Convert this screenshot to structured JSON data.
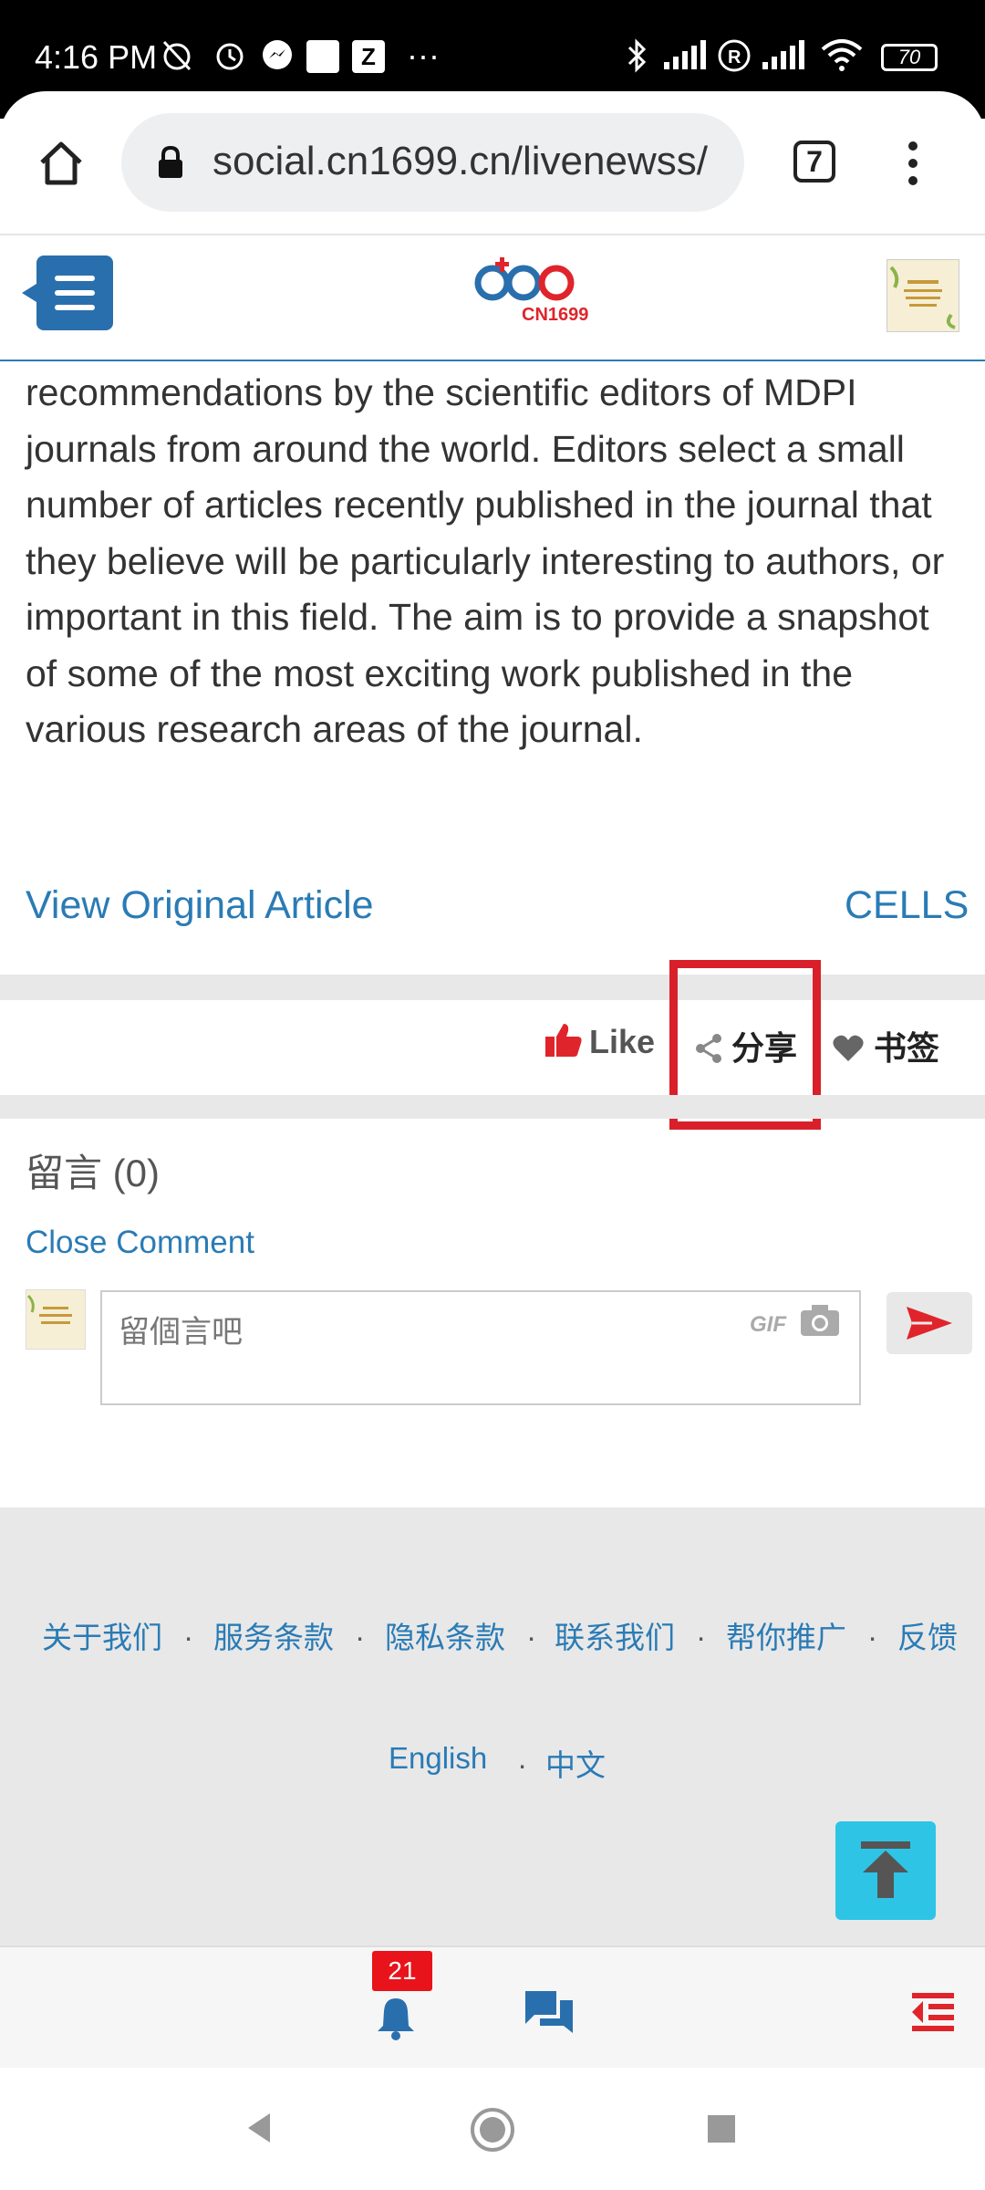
{
  "status_bar": {
    "time": "4:16 PM",
    "battery": "70",
    "overflow": "···"
  },
  "browser": {
    "url": "social.cn1699.cn/livenewss/",
    "tab_count": "7"
  },
  "site_header": {
    "logo_text": "CN1699"
  },
  "article": {
    "body": "recommendations by the scientific editors of MDPI journals from around the world. Editors select a small number of articles recently published in the journal that they believe will be particularly interesting to authors, or important in this field. The aim is to provide a snapshot of some of the most exciting work published in the various research areas of the journal.",
    "view_original": "View Original Article",
    "tag": "CELLS"
  },
  "actions": {
    "like": "Like",
    "share": "分享",
    "bookmark": "书签"
  },
  "comments": {
    "title": "留言 (0)",
    "close": "Close Comment",
    "placeholder": "留個言吧",
    "gif": "GIF"
  },
  "footer": {
    "links": [
      "关于我们",
      "服务条款",
      "隐私条款",
      "联系我们",
      "帮你推广",
      "反馈"
    ],
    "separator": ".",
    "lang_en": "English",
    "lang_zh": "中文"
  },
  "app_nav": {
    "notification_count": "21"
  },
  "colors": {
    "accent_blue": "#2a7bb5",
    "highlight_red": "#d9202a",
    "like_red": "#e0242b",
    "back_top_cyan": "#2ec4e6"
  }
}
